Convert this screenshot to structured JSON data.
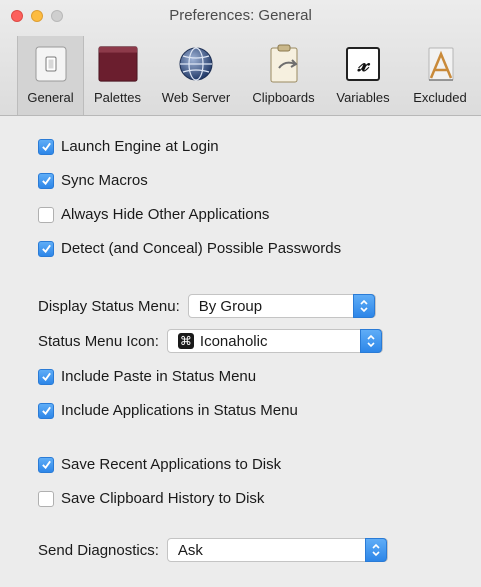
{
  "window": {
    "title": "Preferences: General"
  },
  "toolbar": {
    "items": [
      {
        "label": "General",
        "icon": "general-switch-icon",
        "selected": true
      },
      {
        "label": "Palettes",
        "icon": "palette-window-icon",
        "selected": false
      },
      {
        "label": "Web Server",
        "icon": "globe-icon",
        "selected": false
      },
      {
        "label": "Clipboards",
        "icon": "clipboard-icon",
        "selected": false
      },
      {
        "label": "Variables",
        "icon": "variable-x-icon",
        "selected": false
      },
      {
        "label": "Excluded",
        "icon": "excluded-app-icon",
        "selected": false
      }
    ],
    "variables_glyph": "𝓍"
  },
  "options": {
    "launch_engine": {
      "label": "Launch Engine at Login",
      "checked": true
    },
    "sync_macros": {
      "label": "Sync Macros",
      "checked": true
    },
    "always_hide": {
      "label": "Always Hide Other Applications",
      "checked": false
    },
    "detect_passwords": {
      "label": "Detect (and Conceal) Possible Passwords",
      "checked": true
    },
    "include_paste": {
      "label": "Include Paste in Status Menu",
      "checked": true
    },
    "include_apps": {
      "label": "Include Applications in Status Menu",
      "checked": true
    },
    "save_recent": {
      "label": "Save Recent Applications to Disk",
      "checked": true
    },
    "save_clipboard": {
      "label": "Save Clipboard History to Disk",
      "checked": false
    }
  },
  "popups": {
    "display_status_menu": {
      "label": "Display Status Menu:",
      "value": "By Group"
    },
    "status_menu_icon": {
      "label": "Status Menu Icon:",
      "value": "Iconaholic",
      "icon_glyph": "⌘"
    },
    "send_diagnostics": {
      "label": "Send Diagnostics:",
      "value": "Ask"
    }
  },
  "colors": {
    "accent": "#3b8ff0",
    "window_bg": "#ececec"
  }
}
